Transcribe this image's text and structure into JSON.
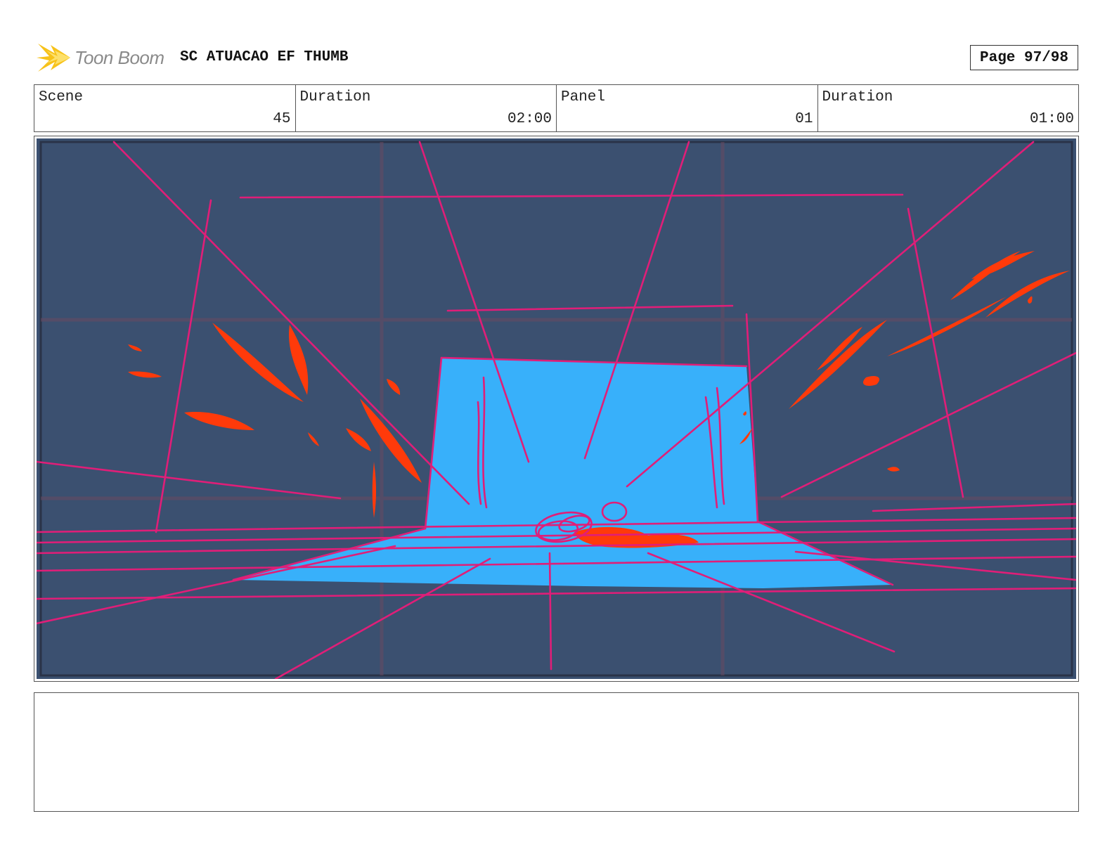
{
  "header": {
    "logo_text": "Toon Boom",
    "title": "SC ATUACAO EF THUMB",
    "page": "Page 97/98"
  },
  "info": {
    "scene_label": "Scene",
    "scene_value": "45",
    "scene_duration_label": "Duration",
    "scene_duration_value": "02:00",
    "panel_label": "Panel",
    "panel_value": "01",
    "panel_duration_label": "Duration",
    "panel_duration_value": "01:00"
  },
  "notes": {
    "text": ""
  },
  "colors": {
    "background": "#3b5070",
    "floor": "#38b0fa",
    "lines": "#e01e78",
    "splatter": "#ff3a0a",
    "grid": "#6a4a60",
    "logo_flame": "#f7c21a"
  }
}
